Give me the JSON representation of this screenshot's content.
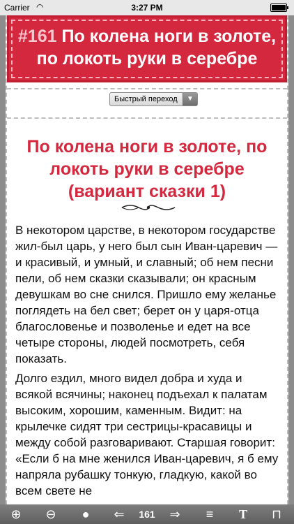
{
  "status_bar": {
    "carrier": "Carrier",
    "time": "3:27 PM"
  },
  "header": {
    "number": "#161",
    "title": "По колена ноги в золоте, по локоть руки в серебре"
  },
  "quick_jump": {
    "label": "Быстрый переход"
  },
  "story": {
    "title": "По колена ноги в золоте, по локоть руки в серебре (вариант сказки 1)",
    "paragraphs": [
      "В некотором царстве, в некотором государстве жил-был царь, у него был сын Иван-царевич — и красивый, и умный, и славный; об нем песни пели, об нем сказки сказывали; он красным девушкам во сне снился. Пришло ему желанье поглядеть на бел свет; берет он у царя-отца благословенье и позволенье и едет на все четыре стороны, людей посмотреть, себя показать.",
      "Долго ездил, много видел добра и худа и всякой всячины; наконец подъехал к палатам высоким, хорошим, каменным. Видит: на крылечке сидят три сестрицы-красавицы и между собой разговаривают. Старшая говорит: «Если б на мне женился Иван-царевич, я б ему напряла рубашку тонкую, гладкую, какой во всем свете не"
    ]
  },
  "toolbar": {
    "page": "161"
  }
}
